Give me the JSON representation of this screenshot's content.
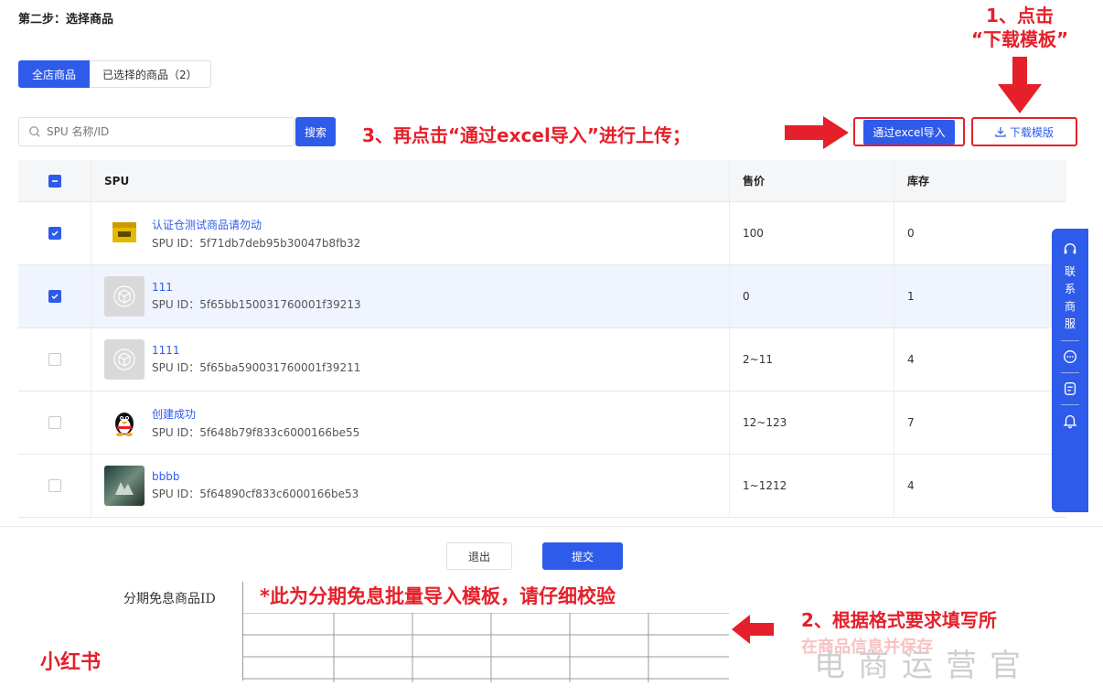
{
  "page": {
    "step_title": "第二步：选择商品"
  },
  "tabs": [
    {
      "label": "全店商品",
      "active": true
    },
    {
      "label": "已选择的商品（2）",
      "active": false
    }
  ],
  "search": {
    "placeholder": "SPU 名称/ID",
    "button_label": "搜索"
  },
  "toolbar": {
    "excel_import_label": "通过excel导入",
    "download_template_label": "下载模版"
  },
  "table": {
    "columns": [
      "SPU",
      "售价",
      "库存"
    ],
    "rows": [
      {
        "checked": true,
        "name": "认证仓测试商品请勿动",
        "spu_id": "SPU ID：5f71db7deb95b30047b8fb32",
        "price": "100",
        "stock": "0",
        "thumb": "yellow-box"
      },
      {
        "checked": true,
        "name": "111",
        "spu_id": "SPU ID：5f65bb150031760001f39213",
        "price": "0",
        "stock": "1",
        "thumb": "placeholder"
      },
      {
        "checked": false,
        "name": "1111",
        "spu_id": "SPU ID：5f65ba590031760001f39211",
        "price": "2~11",
        "stock": "4",
        "thumb": "placeholder"
      },
      {
        "checked": false,
        "name": "创建成功",
        "spu_id": "SPU ID：5f648b79f833c6000166be55",
        "price": "12~123",
        "stock": "7",
        "thumb": "penguin"
      },
      {
        "checked": false,
        "name": "bbbb",
        "spu_id": "SPU ID：5f64890cf833c6000166be53",
        "price": "1~1212",
        "stock": "4",
        "thumb": "photo"
      }
    ]
  },
  "footer": {
    "exit_label": "退出",
    "submit_label": "提交"
  },
  "side_service": {
    "label": "联系商服",
    "chars": [
      "联",
      "系",
      "商",
      "服"
    ]
  },
  "annotations": {
    "step1_line1": "1、点击",
    "step1_line2": "“下载模板”",
    "step3": "3、再点击“通过excel导入”进行上传；",
    "step2": "2、根据格式要求填写所",
    "step2_cut": "在商品信息并保存"
  },
  "template_preview": {
    "header": "分期免息商品ID",
    "warning": "*此为分期免息批量导入模板，请仔细校验"
  },
  "logo": "小红书",
  "signature": "电商运营官",
  "colors": {
    "primary": "#2f5bea",
    "annotation_red": "#e5202a"
  }
}
